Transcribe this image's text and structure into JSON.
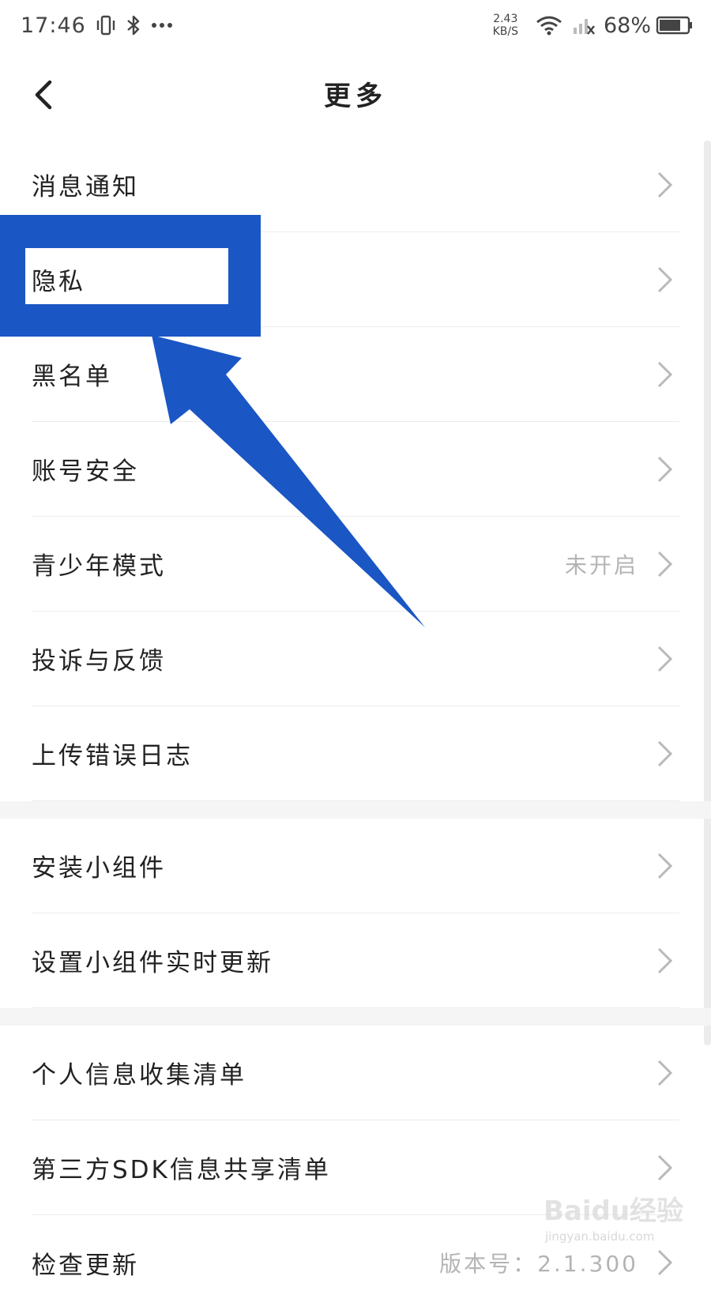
{
  "status_bar": {
    "time": "17:46",
    "icons": [
      "vibrate-icon",
      "bluetooth-icon",
      "more-dots-icon",
      "wifi-icon",
      "signal-icon",
      "battery-icon"
    ],
    "net_speed_value": "2.43",
    "net_speed_unit": "KB/S",
    "battery": "68%"
  },
  "nav": {
    "title": "更多",
    "back_icon": "chevron-left-icon"
  },
  "groups": [
    [
      {
        "label": "消息通知"
      },
      {
        "label": "隐私"
      },
      {
        "label": "黑名单"
      },
      {
        "label": "账号安全"
      },
      {
        "label": "青少年模式",
        "value": "未开启"
      },
      {
        "label": "投诉与反馈"
      },
      {
        "label": "上传错误日志"
      }
    ],
    [
      {
        "label": "安装小组件"
      },
      {
        "label": "设置小组件实时更新"
      }
    ],
    [
      {
        "label": "个人信息收集清单"
      },
      {
        "label": "第三方SDK信息共享清单"
      },
      {
        "label": "检查更新",
        "value": "版本号：2.1.300"
      }
    ]
  ],
  "colors": {
    "annotation_blue": "#1a56c4",
    "chevron_gray": "#b9b9b9",
    "value_gray": "#b4b4b4"
  },
  "watermark": {
    "brand": "Baidu经验",
    "url": "jingyan.baidu.com"
  }
}
